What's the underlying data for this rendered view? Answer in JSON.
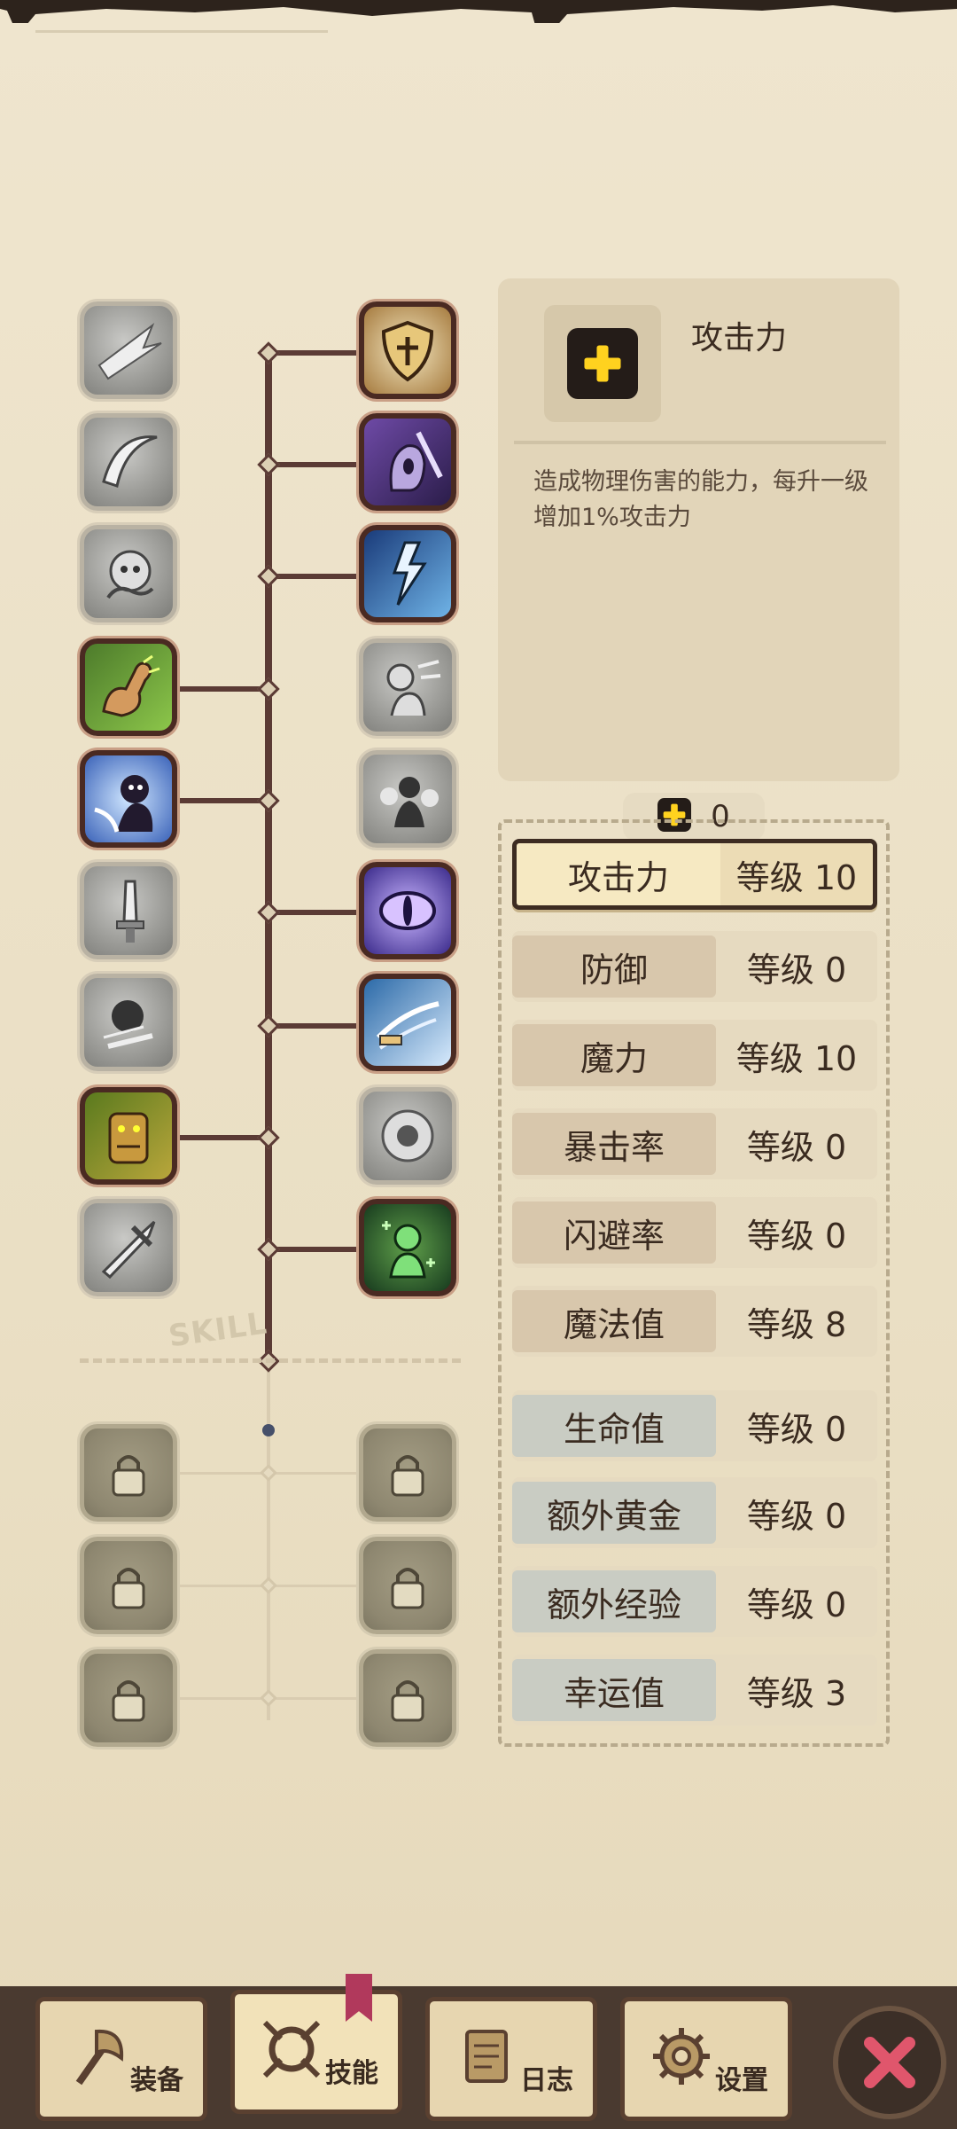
{
  "info": {
    "title": "攻击力",
    "description": "造成物理伤害的能力，每升一级增加1%攻击力",
    "icon": "plus-icon"
  },
  "points": {
    "value": "0",
    "icon": "plus-icon"
  },
  "tree": {
    "label": "SKILL"
  },
  "stats": [
    {
      "name": "攻击力",
      "level": "等级 10",
      "selected": true
    },
    {
      "name": "防御",
      "level": "等级 0"
    },
    {
      "name": "魔力",
      "level": "等级 10"
    },
    {
      "name": "暴击率",
      "level": "等级 0"
    },
    {
      "name": "闪避率",
      "level": "等级 0"
    },
    {
      "name": "魔法值",
      "level": "等级 8"
    },
    {
      "name": "生命值",
      "level": "等级 0"
    },
    {
      "name": "额外黄金",
      "level": "等级 0"
    },
    {
      "name": "额外经验",
      "level": "等级 0"
    },
    {
      "name": "幸运值",
      "level": "等级 3"
    }
  ],
  "nav": {
    "equipment": "装备",
    "skills": "技能",
    "log": "日志",
    "settings": "设置"
  },
  "colors": {
    "accent": "#ffd21f",
    "trunk": "#5b3b35",
    "close": "#e0566c"
  }
}
